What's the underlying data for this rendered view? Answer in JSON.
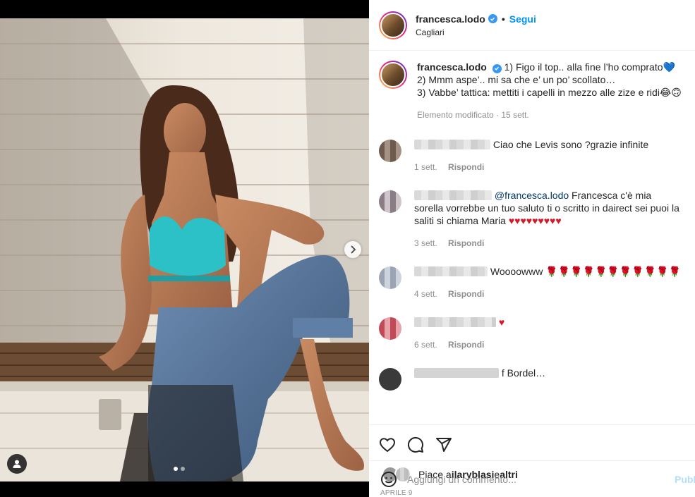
{
  "header": {
    "username": "francesca.lodo",
    "separator": "•",
    "follow_label": "Segui",
    "location": "Cagliari"
  },
  "caption": {
    "username": "francesca.lodo",
    "lines": [
      "1) Figo il top.. alla fine l’ho comprato💙",
      "2) Mmm aspe’.. mi sa che e’ un po’ scollato…",
      "3) Vabbe’ tattica: mettiti i capelli in mezzo alle zize e ridi😂🙃"
    ],
    "meta": "Elemento modificato · 15 sett."
  },
  "comments": [
    {
      "text": "Ciao che Levis sono ?grazie infinite",
      "time": "1 sett.",
      "reply": "Rispondi",
      "avatar_color": "#6e5a4e"
    },
    {
      "mention": "@francesca.lodo",
      "text": " Francesca c'è mia sorella vorrebbe un tuo saluto ti o scritto in dairect sei puoi la saliti si chiama Maria ",
      "hearts": "♥♥♥♥♥♥♥♥♥",
      "time": "3 sett.",
      "reply": "Rispondi",
      "avatar_color": "#8a7d86"
    },
    {
      "text": "Woooowww 🌹🌹🌹🌹🌹🌹🌹🌹🌹🌹🌹",
      "time": "4 sett.",
      "reply": "Rispondi",
      "avatar_color": "#9aa4b4"
    },
    {
      "text": "",
      "hearts": "♥",
      "time": "6 sett.",
      "reply": "Rispondi",
      "avatar_color": "#c24a56"
    }
  ],
  "partial_comment": {
    "text": "f   Bordel…"
  },
  "likes": {
    "prefix": "Piace a ",
    "user": "ilaryblasi",
    "joiner": " e ",
    "others": "altri"
  },
  "date": "APRILE 9",
  "add_comment": {
    "placeholder": "Aggiungi un commento...",
    "publish": "Pubblica"
  },
  "icons": [
    "heart-icon",
    "comment-icon",
    "share-icon",
    "emoji-icon",
    "chevron-right-icon",
    "user-tag-icon"
  ],
  "colors": {
    "accent": "#0095f6",
    "verified": "#3897f0",
    "top": "#2bc1c6"
  },
  "carousel": {
    "total": 2,
    "current": 1
  }
}
